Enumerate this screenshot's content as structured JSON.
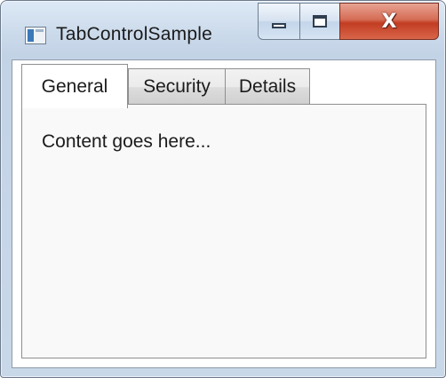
{
  "window": {
    "title": "TabControlSample",
    "icon": "app-window-icon",
    "caption_buttons": {
      "minimize": "minimize-icon",
      "maximize": "maximize-icon",
      "close_glyph": "X"
    }
  },
  "tabs": [
    {
      "label": "General",
      "selected": true
    },
    {
      "label": "Security",
      "selected": false
    },
    {
      "label": "Details",
      "selected": false
    }
  ],
  "content": {
    "text": "Content goes here..."
  },
  "colors": {
    "close_button": "#c23d22",
    "frame": "#c9d8e9"
  }
}
